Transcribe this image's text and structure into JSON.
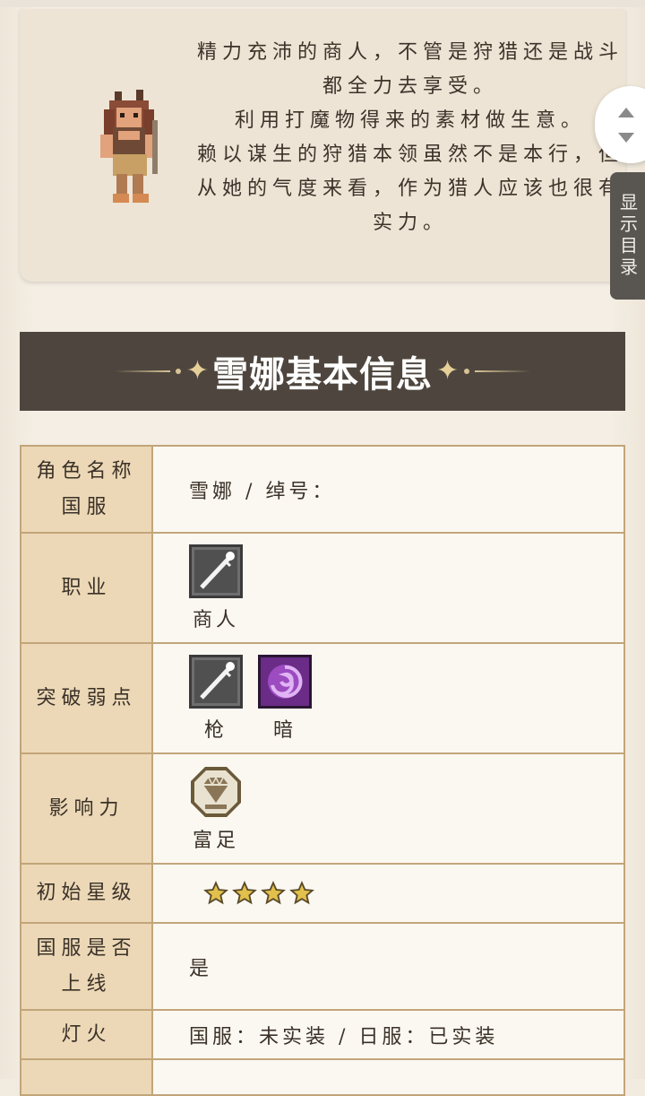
{
  "intro": {
    "lines": [
      "精力充沛的商人，不管是狩猎还是战斗都全力去享受。",
      "利用打魔物得来的素材做生意。",
      "赖以谋生的狩猎本领虽然不是本行，但从她的气度来看，作为猎人应该也很有实力。"
    ]
  },
  "toc_button": {
    "label": "显示目录"
  },
  "section": {
    "title": "雪娜基本信息"
  },
  "info_table": {
    "name_label": "角色名称国服",
    "name_value": "雪娜 / 绰号：",
    "job_label": "职业",
    "job_value": "商人",
    "job_icon": "spear-icon",
    "weak_label": "突破弱点",
    "weaknesses": [
      {
        "label": "枪",
        "icon": "spear-icon"
      },
      {
        "label": "暗",
        "icon": "dark-icon"
      }
    ],
    "influence_label": "影响力",
    "influence_value": "富足",
    "influence_icon": "wealth-gem-icon",
    "rarity_label": "初始星级",
    "stars": 4,
    "release_label": "国服是否上线",
    "release_value": "是",
    "lamp_label": "灯火",
    "lamp_value": "国服：未实装 / 日服：已实装"
  },
  "colors": {
    "header_bg": "#4e463e",
    "label_bg": "#ecd8b6",
    "value_bg": "#fbf8f1",
    "border": "#c2a57a",
    "star": "#e2c04c"
  }
}
